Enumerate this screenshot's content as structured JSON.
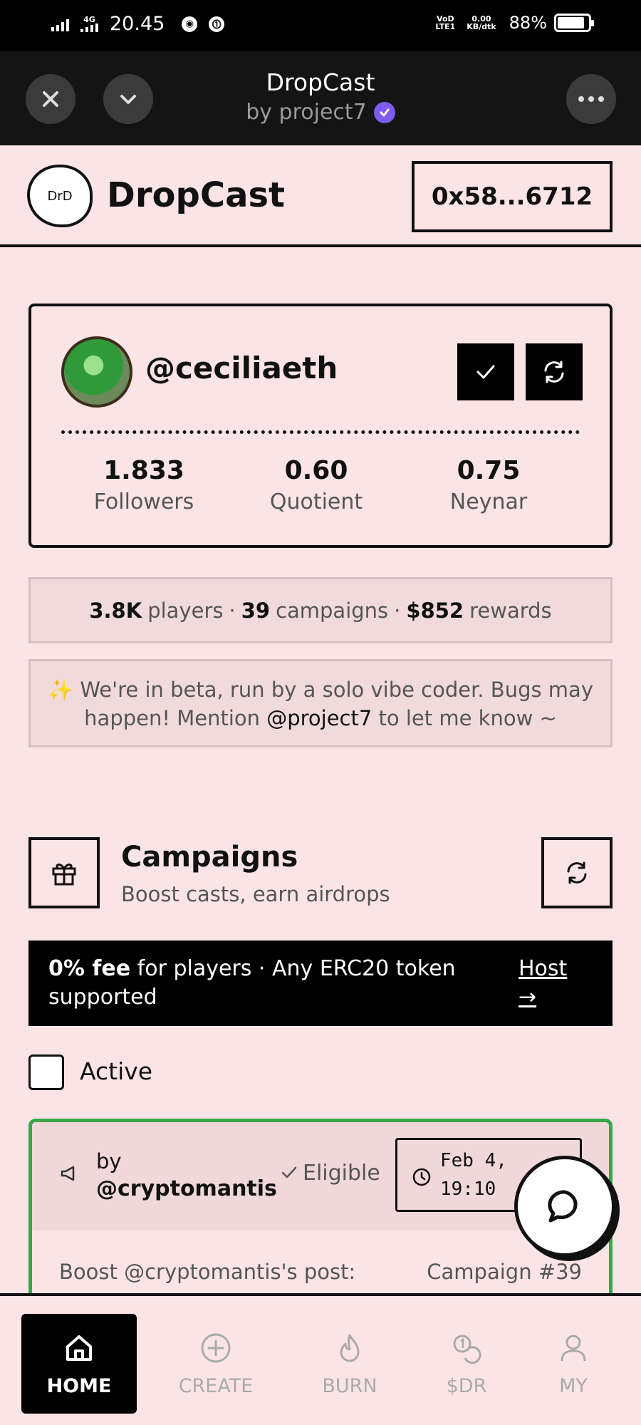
{
  "status_bar": {
    "network": "4G",
    "time": "20.45",
    "volte_top": "VoD",
    "volte_bottom": "LTE1",
    "data_rate_top": "0.00",
    "data_rate_bottom": "KB/dtk",
    "battery": "88%",
    "battery_level": 0.88
  },
  "app_bar": {
    "title": "DropCast",
    "subtitle": "by project7"
  },
  "header": {
    "logo_mark": "DrD",
    "brand": "DropCast",
    "wallet": "0x58...6712"
  },
  "profile": {
    "handle": "@ceciliaeth",
    "stats": [
      {
        "value": "1.833",
        "label": "Followers"
      },
      {
        "value": "0.60",
        "label": "Quotient"
      },
      {
        "value": "0.75",
        "label": "Neynar"
      }
    ]
  },
  "summary": {
    "players_value": "3.8K",
    "players_label": "players",
    "campaigns_value": "39",
    "campaigns_label": "campaigns",
    "rewards_value": "$852",
    "rewards_label": "rewards",
    "sep": "·"
  },
  "beta": {
    "emoji": "✨",
    "text_1": "We're in beta, run by a solo vibe coder. Bugs may",
    "text_2a": "happen! Mention",
    "mention": "@project7",
    "text_2b": "to let me know ~"
  },
  "campaigns": {
    "title": "Campaigns",
    "subtitle": "Boost casts, earn airdrops",
    "fee_bold": "0% fee",
    "fee_rest": "for players · Any ERC20 token",
    "fee_line2": "supported",
    "host_label": "Host",
    "host_arrow": "→",
    "active_label": "Active"
  },
  "campaign_card": {
    "by": "by",
    "author": "@cryptomantis",
    "eligible": "Eligible",
    "date_line1": "Feb 4,",
    "date_line2": "19:10",
    "body_text": "Boost @cryptomantis's post:",
    "campaign_no": "Campaign #39"
  },
  "nav": {
    "home": "HOME",
    "create": "CREATE",
    "burn": "BURN",
    "dr": "$DR",
    "my": "MY"
  },
  "colors": {
    "background": "#fbe4e6",
    "card_border_green": "#3aa64a",
    "verified_purple": "#7c5cf0"
  }
}
